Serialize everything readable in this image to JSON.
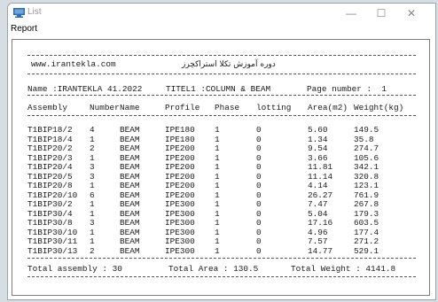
{
  "window": {
    "title": "List",
    "minimize_glyph": "—",
    "maximize_glyph": "☐",
    "close_glyph": "✕"
  },
  "menu": {
    "report_label": "Report"
  },
  "report": {
    "site": "www.irantekla.com",
    "persian_title": "دوره آموزش تکلا استراکچرز",
    "name_line": "Name :IRANTEKLA 41.2022",
    "title_line": "TITEL1 :COLUMN & BEAM",
    "page_line": "Page number :  1",
    "columns": [
      "Assembly",
      "Number",
      "Name",
      "Profile",
      "Phase",
      "lotting",
      "Area(m2)",
      "Weight(kg)"
    ],
    "rows": [
      [
        "T1BIP18/2",
        "4",
        "BEAM",
        "IPE180",
        "1",
        "0",
        "5.60",
        "149.5"
      ],
      [
        "T1BIP18/4",
        "1",
        "BEAM",
        "IPE180",
        "1",
        "0",
        "1.34",
        "35.8"
      ],
      [
        "T1BIP20/2",
        "2",
        "BEAM",
        "IPE200",
        "1",
        "0",
        "9.54",
        "274.7"
      ],
      [
        "T1BIP20/3",
        "1",
        "BEAM",
        "IPE200",
        "1",
        "0",
        "3.66",
        "105.6"
      ],
      [
        "T1BIP20/4",
        "3",
        "BEAM",
        "IPE200",
        "1",
        "0",
        "11.81",
        "342.1"
      ],
      [
        "T1BIP20/5",
        "3",
        "BEAM",
        "IPE200",
        "1",
        "0",
        "11.14",
        "320.8"
      ],
      [
        "T1BIP20/8",
        "1",
        "BEAM",
        "IPE200",
        "1",
        "0",
        "4.14",
        "123.1"
      ],
      [
        "T1BIP20/10",
        "6",
        "BEAM",
        "IPE200",
        "1",
        "0",
        "26.27",
        "761.9"
      ],
      [
        "T1BIP30/2",
        "1",
        "BEAM",
        "IPE300",
        "1",
        "0",
        "7.47",
        "267.8"
      ],
      [
        "T1BIP30/4",
        "1",
        "BEAM",
        "IPE300",
        "1",
        "0",
        "5.04",
        "179.3"
      ],
      [
        "T1BIP30/8",
        "3",
        "BEAM",
        "IPE300",
        "1",
        "0",
        "17.16",
        "603.5"
      ],
      [
        "T1BIP30/10",
        "1",
        "BEAM",
        "IPE300",
        "1",
        "0",
        "4.96",
        "177.4"
      ],
      [
        "T1BIP30/11",
        "1",
        "BEAM",
        "IPE300",
        "1",
        "0",
        "7.57",
        "271.2"
      ],
      [
        "T1BIP30/13",
        "2",
        "BEAM",
        "IPE300",
        "1",
        "0",
        "14.77",
        "529.1"
      ]
    ],
    "totals": {
      "assembly": "Total assembly : 30",
      "area": "Total Area : 130.5",
      "weight": "Total Weight : 4141.8"
    }
  },
  "colors": {
    "accent": "#2f6fb4",
    "text": "#1a1a1a"
  }
}
